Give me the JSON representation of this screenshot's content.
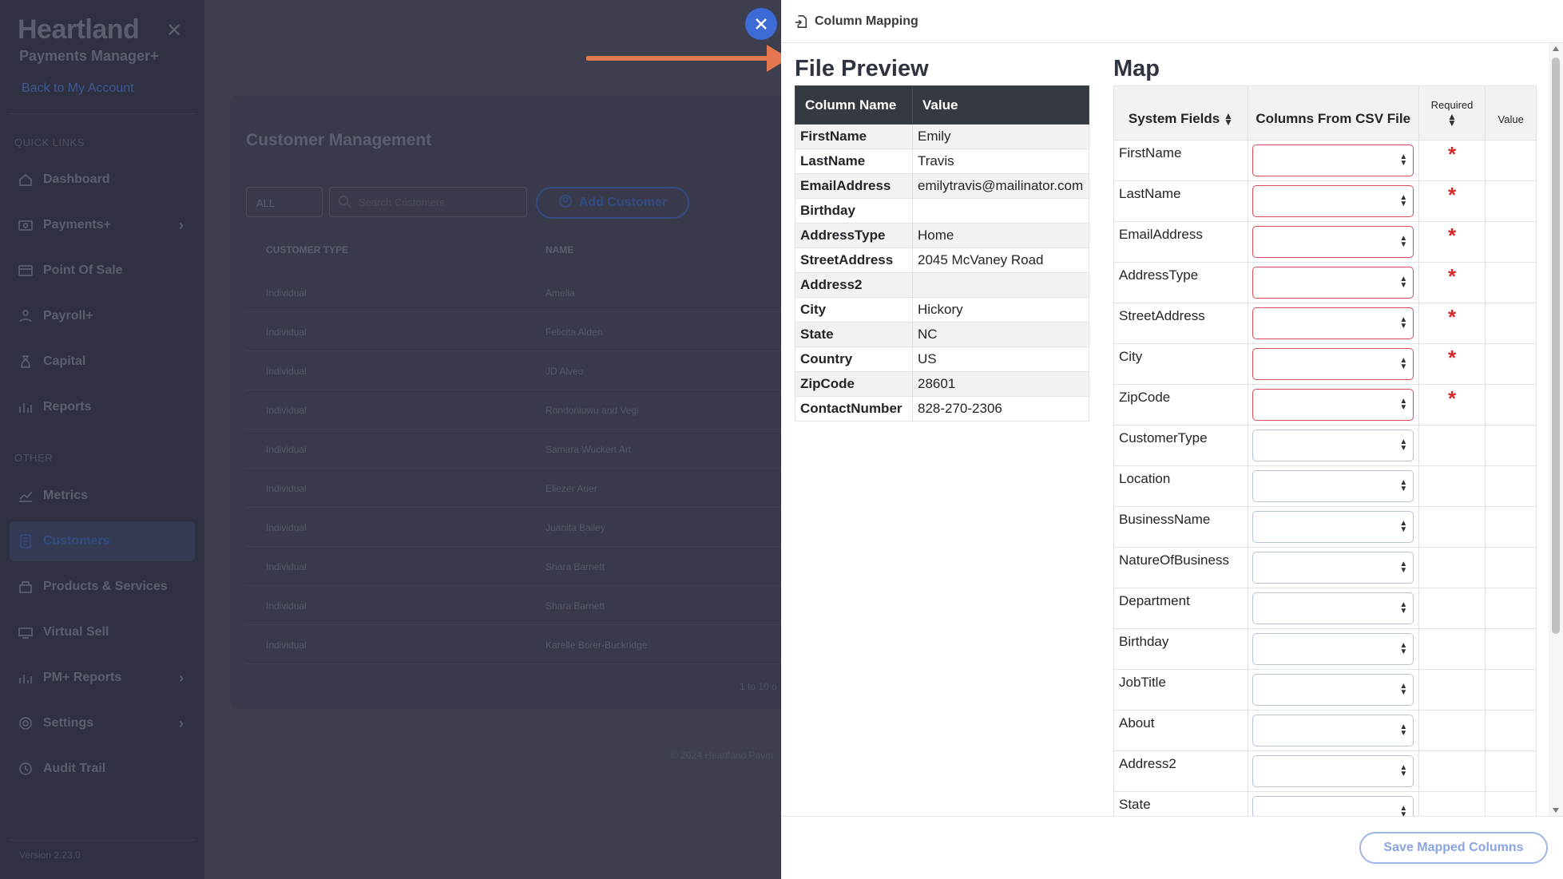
{
  "sidebar": {
    "brand": "Heartland",
    "subtitle": "Payments Manager+",
    "back_link": "Back to My Account",
    "quick_links_label": "QUICK LINKS",
    "other_label": "OTHER",
    "items": [
      {
        "label": "Dashboard",
        "icon": "dashboard-icon"
      },
      {
        "label": "Payments+",
        "icon": "payments-icon"
      },
      {
        "label": "Point Of Sale",
        "icon": "pos-icon"
      },
      {
        "label": "Payroll+",
        "icon": "payroll-icon"
      },
      {
        "label": "Capital",
        "icon": "capital-icon"
      },
      {
        "label": "Reports",
        "icon": "reports-icon"
      }
    ],
    "other_items": [
      {
        "label": "Metrics",
        "icon": "metrics-icon"
      },
      {
        "label": "Customers",
        "icon": "customers-icon"
      },
      {
        "label": "Products & Services",
        "icon": "products-icon"
      },
      {
        "label": "Virtual Sell",
        "icon": "virtual-sell-icon"
      },
      {
        "label": "PM+ Reports",
        "icon": "pm-reports-icon"
      },
      {
        "label": "Settings",
        "icon": "settings-icon"
      },
      {
        "label": "Audit Trail",
        "icon": "audit-trail-icon"
      }
    ],
    "version": "Version 2.23.0"
  },
  "background": {
    "page_title": "Customer Management",
    "filter_value": "ALL",
    "search_placeholder": "Search Customers",
    "add_customer_label": "Add Customer",
    "columns": [
      "CUSTOMER TYPE",
      "NAME"
    ],
    "rows": [
      [
        "Individual",
        "Amelia"
      ],
      [
        "Individual",
        "Felicita Alden"
      ],
      [
        "Individual",
        "JD Alveo"
      ],
      [
        "Individual",
        "Rondoniuwu and Vegi"
      ],
      [
        "Individual",
        "Samara Wuckert Art"
      ],
      [
        "Individual",
        "Eliezer Auer"
      ],
      [
        "Individual",
        "Juanita Bailey"
      ],
      [
        "Individual",
        "Shara Barnett"
      ],
      [
        "Individual",
        "Shara Barnett"
      ],
      [
        "Individual",
        "Karelle Borer-Buckridge"
      ]
    ],
    "pager": "1 to 10 o",
    "footer": "© 2024 Heartland Paym"
  },
  "drawer": {
    "title": "Column Mapping",
    "file_preview_title": "File Preview",
    "preview_headers": {
      "name": "Column Name",
      "value": "Value"
    },
    "preview_rows": [
      {
        "name": "FirstName",
        "value": "Emily"
      },
      {
        "name": "LastName",
        "value": "Travis"
      },
      {
        "name": "EmailAddress",
        "value": "emilytravis@mailinator.com"
      },
      {
        "name": "Birthday",
        "value": ""
      },
      {
        "name": "AddressType",
        "value": "Home"
      },
      {
        "name": "StreetAddress",
        "value": "2045 McVaney Road"
      },
      {
        "name": "Address2",
        "value": ""
      },
      {
        "name": "City",
        "value": "Hickory"
      },
      {
        "name": "State",
        "value": "NC"
      },
      {
        "name": "Country",
        "value": "US"
      },
      {
        "name": "ZipCode",
        "value": "28601"
      },
      {
        "name": "ContactNumber",
        "value": "828-270-2306"
      }
    ],
    "map_title": "Map",
    "map_headers": {
      "system_fields": "System Fields",
      "csv_columns": "Columns From CSV File",
      "required": "Required",
      "value": "Value"
    },
    "required_mark": "*",
    "map_rows": [
      {
        "field": "FirstName",
        "required": true
      },
      {
        "field": "LastName",
        "required": true
      },
      {
        "field": "EmailAddress",
        "required": true
      },
      {
        "field": "AddressType",
        "required": true
      },
      {
        "field": "StreetAddress",
        "required": true
      },
      {
        "field": "City",
        "required": true
      },
      {
        "field": "ZipCode",
        "required": true
      },
      {
        "field": "CustomerType",
        "required": false
      },
      {
        "field": "Location",
        "required": false
      },
      {
        "field": "BusinessName",
        "required": false
      },
      {
        "field": "NatureOfBusiness",
        "required": false
      },
      {
        "field": "Department",
        "required": false
      },
      {
        "field": "Birthday",
        "required": false
      },
      {
        "field": "JobTitle",
        "required": false
      },
      {
        "field": "About",
        "required": false
      },
      {
        "field": "Address2",
        "required": false
      },
      {
        "field": "State",
        "required": false
      }
    ],
    "save_label": "Save Mapped Columns"
  },
  "colors": {
    "accent": "#3d6bd6",
    "annotation_arrow": "#e47650",
    "required": "#d62828",
    "table_header_dark": "#343a40"
  }
}
